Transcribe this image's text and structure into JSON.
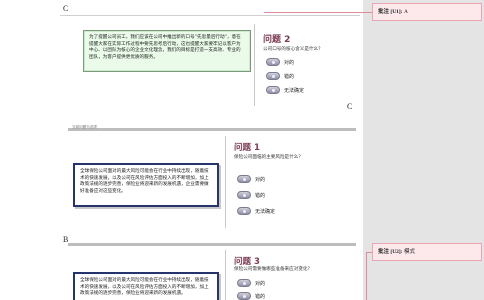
{
  "letters": {
    "c_top": "C",
    "c_right": "C",
    "b": "B"
  },
  "block1": {
    "text": "为了提醒公司员工，我们应该在公司中推出新的口号“先思量后行动”，意在提醒大家在实际工作过程中要先思考后行动，这也提醒大家要牢记以客户为中心、以团队为核心的企业文化理念，我们的目标是打造一支高效、专业的团队，为客户提供更优质的服务。",
    "question_title": "问题 2",
    "question_text": "公司口号的核心含义是什么？",
    "options": [
      "对的",
      "错的",
      "无法确定"
    ]
  },
  "block2": {
    "header_text": "当前问题与选项",
    "text": "全球保险公司面对的最大风险可能会在行业中持续出现，随着技术的快速发展，以及公司在风险评估方面投入的不断增加，加上政策法规的逐步完善，保险业将迎来新的发展机遇，企业需要做好准备应对这些变化。",
    "question_title": "问题 1",
    "question_text": "保险公司面临的主要风险是什么？",
    "options": [
      "对的",
      "错的",
      "无法确定"
    ]
  },
  "block3": {
    "text": "全球保险公司面对的最大风险可能会在行业中持续出现，随着技术的快速发展，以及公司在风险评估方面投入的不断增加，加上政策法规的逐步完善，保险业将迎来新的发展机遇。",
    "question_title": "问题 3",
    "question_text": "保险公司需要做哪些准备来应对变化？",
    "options": [
      "对的",
      "错的"
    ]
  },
  "comments": [
    {
      "label": "批注 [U1]:",
      "text": "A"
    },
    {
      "label": "批注 [U2]:",
      "text": "模式"
    }
  ]
}
